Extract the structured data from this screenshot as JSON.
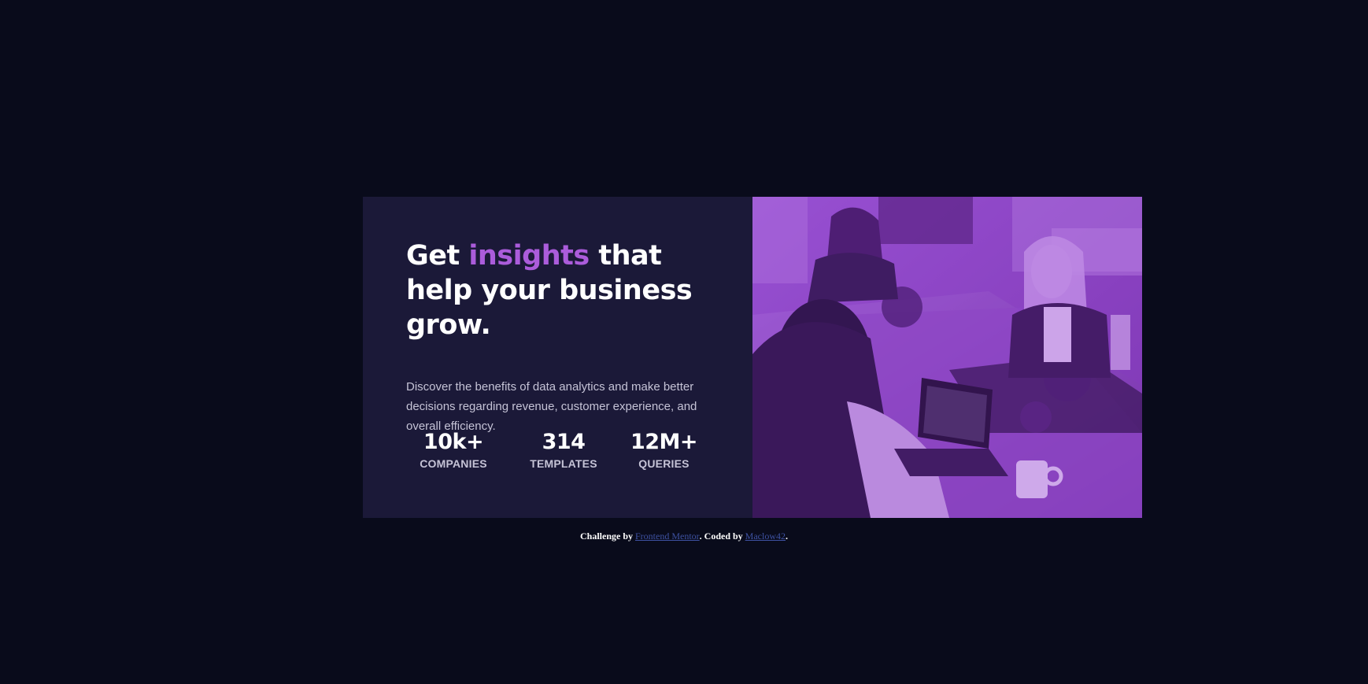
{
  "headline": {
    "before": "Get ",
    "accent": "insights",
    "after": " that help your business grow."
  },
  "description": "Discover the benefits of data analytics and make better decisions regarding revenue, customer experience, and overall efficiency.",
  "stats": [
    {
      "value": "10k+",
      "label": "COMPANIES"
    },
    {
      "value": "314",
      "label": "TEMPLATES"
    },
    {
      "value": "12M+",
      "label": "QUERIES"
    }
  ],
  "footer": {
    "challenge_prefix": "Challenge by ",
    "challenge_link": "Frontend Mentor",
    "coded_prefix": ". Coded by ",
    "coder_link": "Maclow42",
    "suffix": "."
  },
  "colors": {
    "page_background": "#090b1b",
    "card_background": "#1b1938",
    "accent": "#ab5cdb",
    "image_overlay": "#8d3fc7",
    "link": "#3e52a3"
  },
  "icons": {
    "hero_image": "team-meeting-photo"
  }
}
